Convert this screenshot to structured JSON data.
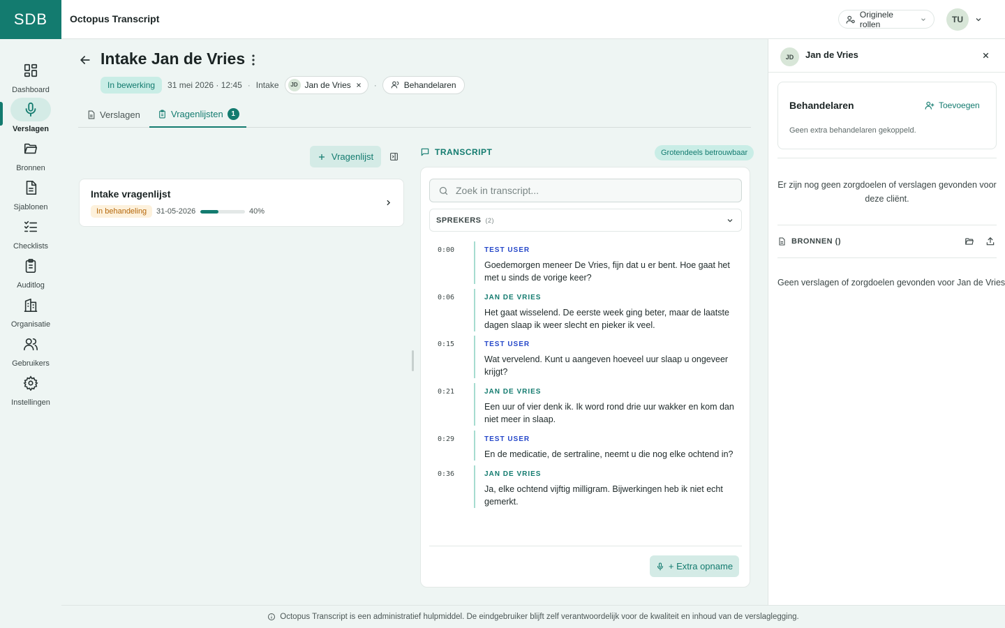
{
  "header": {
    "logo": "SDB",
    "app_title": "Octopus Transcript",
    "roles_label": "Originele rollen",
    "user_initials": "TU"
  },
  "sidebar": {
    "items": [
      {
        "label": "Dashboard",
        "icon": "dashboard-icon"
      },
      {
        "label": "Verslagen",
        "icon": "mic-icon",
        "active": true
      },
      {
        "label": "Bronnen",
        "icon": "folder-icon"
      },
      {
        "label": "Sjablonen",
        "icon": "document-icon"
      },
      {
        "label": "Checklists",
        "icon": "checklist-icon"
      },
      {
        "label": "Auditlog",
        "icon": "clipboard-icon"
      },
      {
        "label": "Organisatie",
        "icon": "building-icon"
      },
      {
        "label": "Gebruikers",
        "icon": "users-icon"
      },
      {
        "label": "Instellingen",
        "icon": "gear-icon"
      }
    ]
  },
  "page": {
    "title": "Intake Jan de Vries",
    "status": "In bewerking",
    "datetime": "31 mei 2026 · 12:45",
    "type": "Intake",
    "client_initials": "JD",
    "client_name": "Jan de Vries",
    "behandelaren_label": "Behandelaren",
    "sep": "·"
  },
  "tabs": [
    {
      "label": "Verslagen"
    },
    {
      "label": "Vragenlijsten",
      "count": "1",
      "active": true
    }
  ],
  "questionnaires": {
    "add_label": "Vragenlijst",
    "items": [
      {
        "title": "Intake vragenlijst",
        "status": "In behandeling",
        "date": "31-05-2026",
        "progress": 0.4,
        "progress_label": "40%"
      }
    ]
  },
  "transcript": {
    "heading": "TRANSCRIPT",
    "reliability": "Grotendeels betrouwbaar",
    "search_placeholder": "Zoek in transcript...",
    "speakers_label": "SPREKERS",
    "speakers_count": "(2)",
    "segments": [
      {
        "time": "0:00",
        "speaker": "TEST USER",
        "role": "user",
        "text": "Goedemorgen meneer De Vries, fijn dat u er bent. Hoe gaat het met u sinds de vorige keer?"
      },
      {
        "time": "0:06",
        "speaker": "JAN DE VRIES",
        "role": "client",
        "text": "Het gaat wisselend. De eerste week ging beter, maar de laatste dagen slaap ik weer slecht en pieker ik veel."
      },
      {
        "time": "0:15",
        "speaker": "TEST USER",
        "role": "user",
        "text": "Wat vervelend. Kunt u aangeven hoeveel uur slaap u ongeveer krijgt?"
      },
      {
        "time": "0:21",
        "speaker": "JAN DE VRIES",
        "role": "client",
        "text": "Een uur of vier denk ik. Ik word rond drie uur wakker en kom dan niet meer in slaap."
      },
      {
        "time": "0:29",
        "speaker": "TEST USER",
        "role": "user",
        "text": "En de medicatie, de sertraline, neemt u die nog elke ochtend in?"
      },
      {
        "time": "0:36",
        "speaker": "JAN DE VRIES",
        "role": "client",
        "text": "Ja, elke ochtend vijftig milligram. Bijwerkingen heb ik niet echt gemerkt."
      }
    ],
    "extra_recording_label": "+ Extra opname"
  },
  "right_panel": {
    "client_initials": "JD",
    "client_name": "Jan de Vries",
    "behandelaren_title": "Behandelaren",
    "add_label": "Toevoegen",
    "behandelaren_empty": "Geen extra behandelaren gekoppeld.",
    "no_goals_message": "Er zijn nog geen zorgdoelen of verslagen gevonden voor deze cliënt.",
    "bronnen_label": "BRONNEN ()",
    "no_reports_message": "Geen verslagen of zorgdoelen gevonden voor Jan de Vries."
  },
  "footer": {
    "disclaimer": "Octopus Transcript is een administratief hulpmiddel. De eindgebruiker blijft zelf verantwoordelijk voor de kwaliteit en inhoud van de verslaglegging."
  },
  "colors": {
    "brand": "#137b6f",
    "brand_light": "#d4ebe6",
    "background": "#eef5f3",
    "user_speaker": "#2547c9",
    "warning": "#b5670a"
  }
}
